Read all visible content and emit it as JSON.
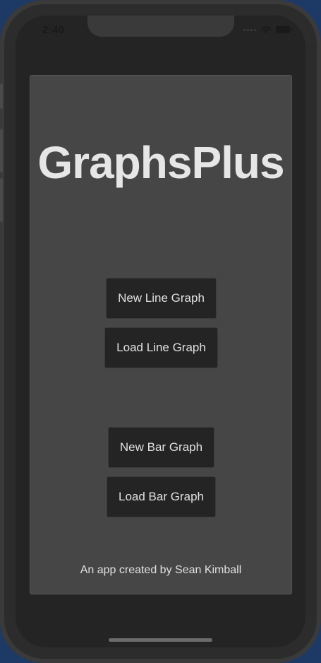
{
  "status_bar": {
    "time": "2:40",
    "signal_icon": "signal-dots-icon",
    "wifi_icon": "wifi-icon",
    "battery_icon": "battery-icon"
  },
  "app": {
    "title": "GraphsPlus",
    "buttons": {
      "new_line_graph": "New Line Graph",
      "load_line_graph": "Load Line Graph",
      "new_bar_graph": "New Bar Graph",
      "load_bar_graph": "Load Bar Graph"
    },
    "footer": "An app created by Sean Kimball"
  },
  "colors": {
    "background": "#242424",
    "card": "#464646",
    "button": "#242424",
    "text": "#e0e0e0"
  }
}
